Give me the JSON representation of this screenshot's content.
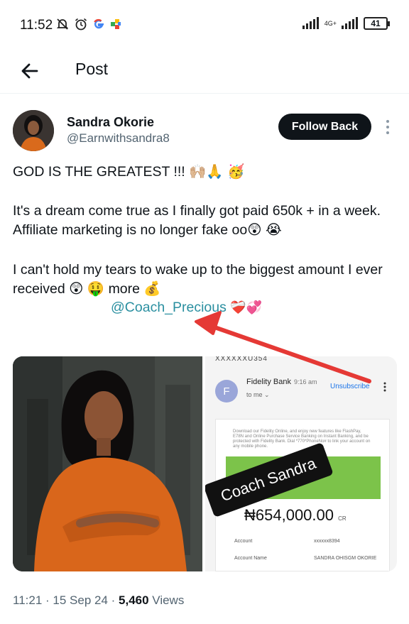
{
  "status_bar": {
    "time": "11:52",
    "network": "4G+",
    "battery": "41",
    "icons": [
      "mute-bell-icon",
      "alarm-icon",
      "google-icon",
      "app-icon",
      "signal-icon",
      "battery-icon"
    ]
  },
  "header": {
    "title": "Post"
  },
  "author": {
    "name": "Sandra Okorie",
    "handle": "@Earnwithsandra8",
    "follow_label": "Follow Back"
  },
  "post": {
    "line1": "GOD IS THE GREATEST !!! 🙌🏼🙏 🥳",
    "line2": "It's a dream come true as I finally got paid 650k + in a week. Affiliate marketing is no longer fake oo😲 😭",
    "line3": "I can't hold my tears to wake up to the biggest amount I ever received  😲 🤑 more 💰",
    "mention": "@Coach_Precious",
    "mention_emojis": "❤️‍🩹💞"
  },
  "email_screenshot": {
    "header_fragment": "XXXXXXU354",
    "avatar_letter": "F",
    "sender": "Fidelity Bank",
    "time": "9:16 am",
    "to": "to me ⌄",
    "unsubscribe": "Unsubscribe",
    "fine_print": "Download our Fidelity Online, and enjoy new features like FlashPay, E78N and Online Purchase Service Banking on Instant Banking, and be protected with Fidelity Bank. Dial *770*PhoneNo# to link your account on any mobile phone.",
    "amount": "₦654,000.00",
    "amount_suffix": "CR",
    "rows": [
      {
        "label": "Account",
        "value": "xxxxxx8394"
      },
      {
        "label": "Account Name",
        "value": "SANDRA OHISGM OKORIE"
      }
    ],
    "stamp": "Coach Sandra"
  },
  "meta": {
    "time": "11:21 · 15 Sep 24 · ",
    "views_count": "5,460",
    "views_label": " Views"
  },
  "colors": {
    "text": "#0f1419",
    "secondary": "#536471",
    "link": "#2a8fa0",
    "arrow": "#e53935",
    "follow_bg": "#0f1419",
    "bank_green": "#7cc34a"
  }
}
